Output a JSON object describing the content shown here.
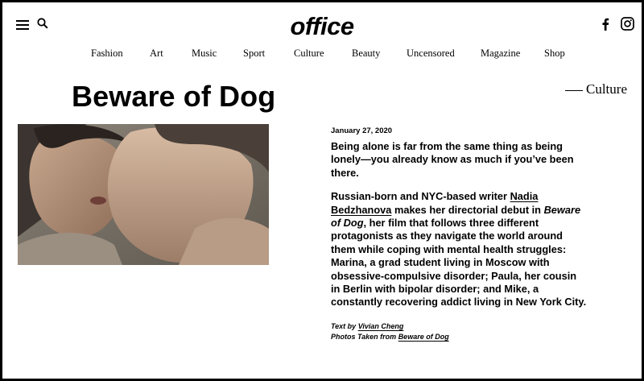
{
  "brand": {
    "logo_text": "office"
  },
  "nav": {
    "items": [
      {
        "label": "Fashion",
        "left": 0
      },
      {
        "label": "Art"
      },
      {
        "label": "Music"
      },
      {
        "label": "Sport"
      },
      {
        "label": "Culture"
      },
      {
        "label": "Beauty"
      },
      {
        "label": "Uncensored"
      },
      {
        "label": "Magazine"
      },
      {
        "label": "Shop"
      }
    ]
  },
  "icons": {
    "menu": "hamburger-menu-icon",
    "search": "search-icon",
    "facebook": "facebook-icon",
    "instagram": "instagram-icon"
  },
  "article": {
    "title": "Beware of Dog",
    "section": "Culture",
    "date": "January 27, 2020",
    "lede": "Being alone is far from the same thing as being lonely—you already know as much if you’ve been there.",
    "body": {
      "p1_before": "Russian-born and NYC-based writer ",
      "p1_link": "Nadia Bedzhanova",
      "p1_middle": " makes her directorial debut in ",
      "p1_film": "Beware of Dog",
      "p1_after": ", her film that follows three different protagonists as they navigate the world around them while coping with mental health struggles: Marina, a grad student living in Moscow with obsessive-compulsive disorder; Paula, her cousin in Berlin with bipolar disorder; and Mike, a constantly recovering addict living in New York City."
    },
    "credits": {
      "text_by_label": "Text by ",
      "text_by_name": "Vivian Cheng",
      "photos_label": "Photos Taken from ",
      "photos_source": "Beware of Dog"
    }
  }
}
